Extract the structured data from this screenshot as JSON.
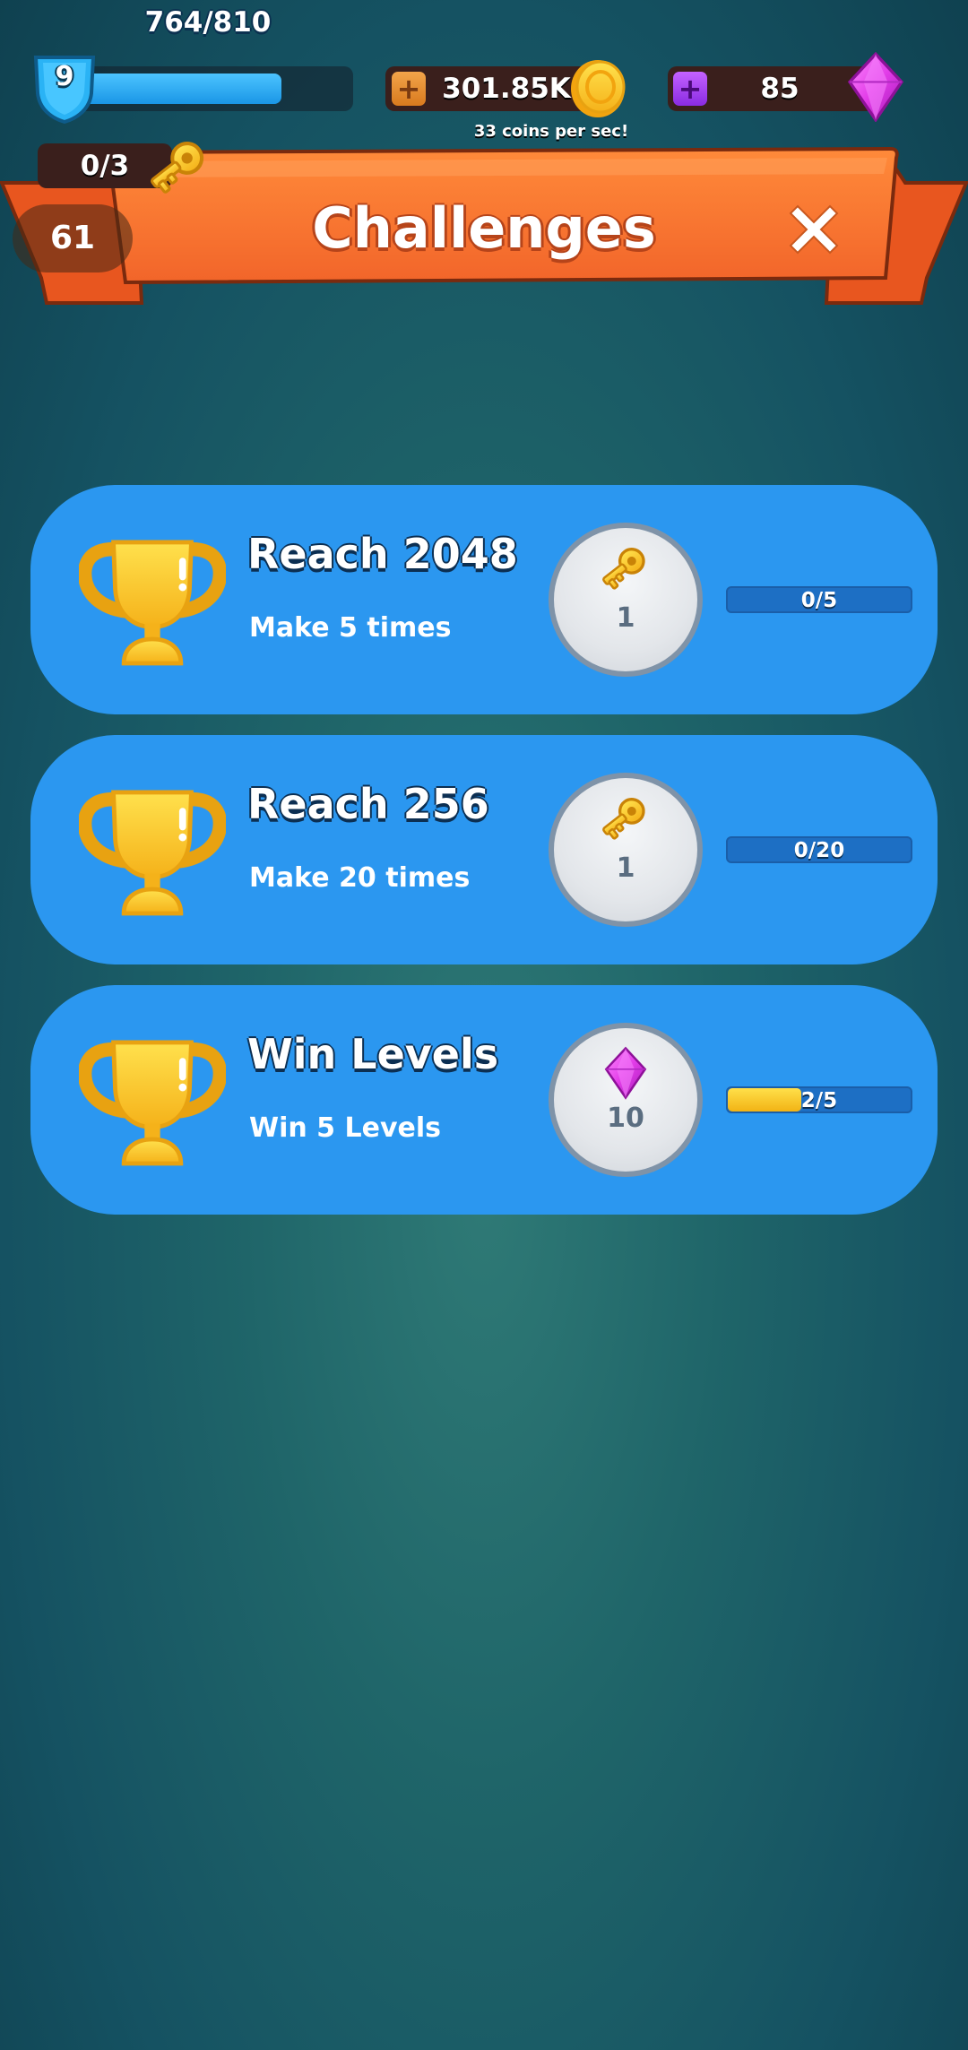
{
  "hud": {
    "level": "9",
    "xp_text": "764/810",
    "xp_fraction": 0.943,
    "coins": "301.85K",
    "coin_rate": "33 coins per sec!",
    "gems": "85",
    "coin_plus": "+",
    "gem_plus": "+"
  },
  "header": {
    "keys": "0/3",
    "timer": "61",
    "title": "Challenges",
    "close_icon": "close-icon"
  },
  "challenges": [
    {
      "title": "Reach 2048",
      "subtitle": "Make 5 times",
      "reward_icon": "key-icon",
      "reward_amount": "1",
      "progress_text": "0/5",
      "progress_fraction": 0.0
    },
    {
      "title": "Reach 256",
      "subtitle": "Make 20 times",
      "reward_icon": "key-icon",
      "reward_amount": "1",
      "progress_text": "0/20",
      "progress_fraction": 0.0
    },
    {
      "title": "Win Levels",
      "subtitle": "Win 5 Levels",
      "reward_icon": "gem-icon",
      "reward_amount": "10",
      "progress_text": "2/5",
      "progress_fraction": 0.4
    }
  ],
  "colors": {
    "card": "#2b97f0",
    "banner": "#ff7a2e",
    "progress_fill": "#f2b315",
    "gem": "#e93cf0",
    "gold": "#ffc61a"
  }
}
